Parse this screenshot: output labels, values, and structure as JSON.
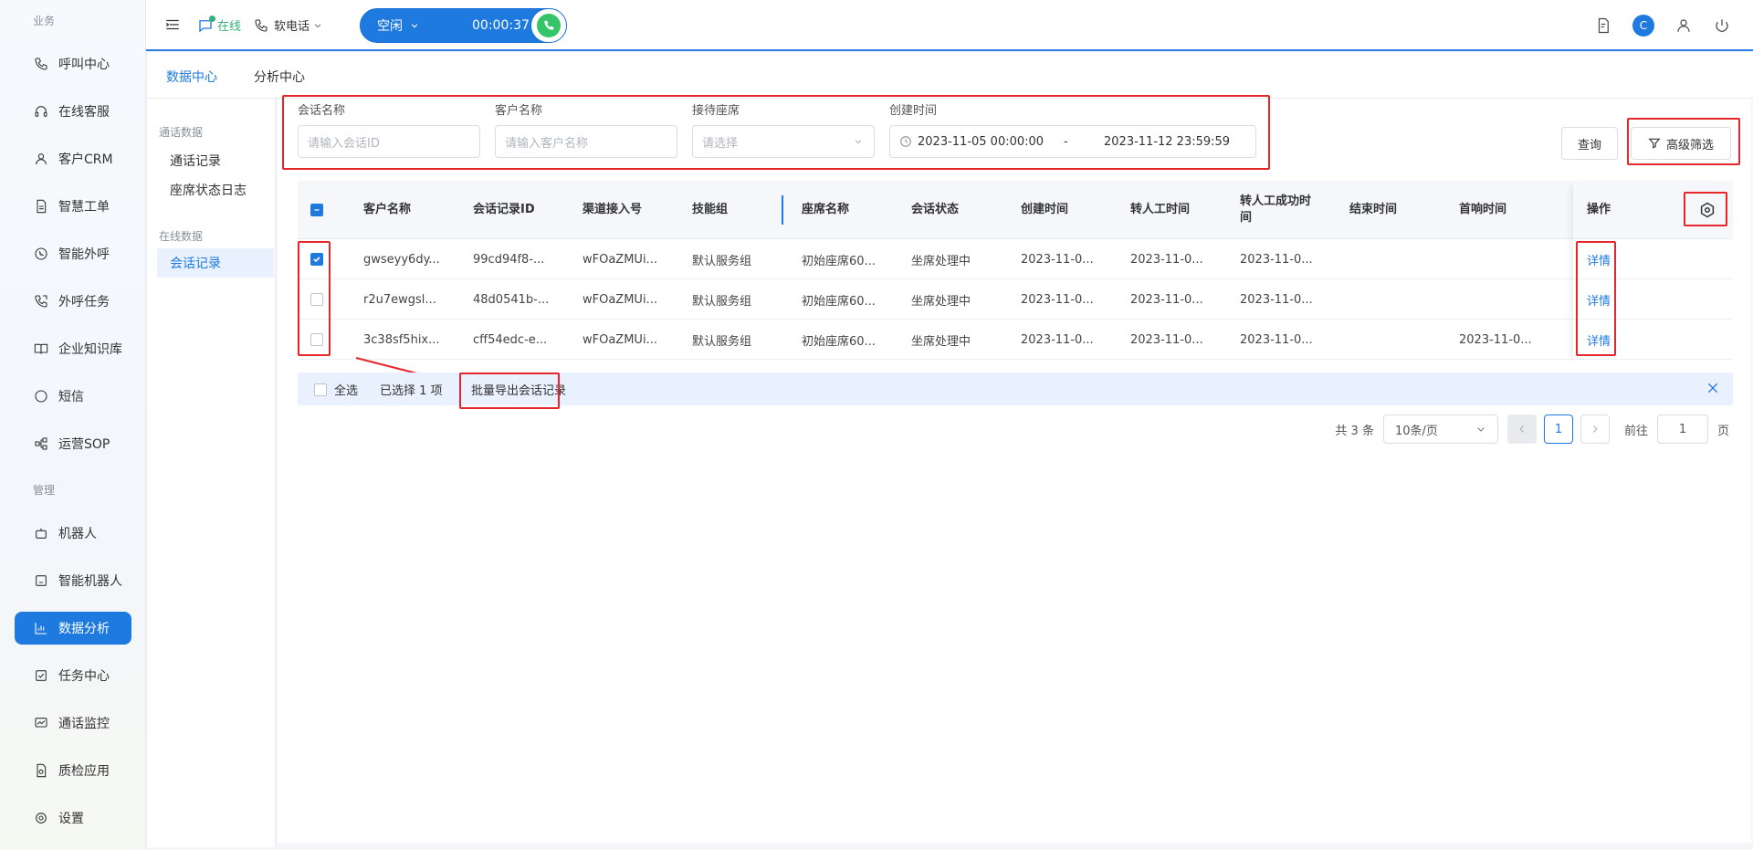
{
  "nav": {
    "group_business": "业务",
    "group_manage": "管理",
    "items": [
      {
        "label": "呼叫中心",
        "icon": "phone-icon"
      },
      {
        "label": "在线客服",
        "icon": "headset-icon"
      },
      {
        "label": "客户CRM",
        "icon": "user-icon"
      },
      {
        "label": "智慧工单",
        "icon": "document-icon"
      },
      {
        "label": "智能外呼",
        "icon": "whatsapp-phone-icon"
      },
      {
        "label": "外呼任务",
        "icon": "phone-task-icon"
      },
      {
        "label": "企业知识库",
        "icon": "book-icon"
      },
      {
        "label": "短信",
        "icon": "sms-icon"
      },
      {
        "label": "运营SOP",
        "icon": "flow-icon"
      },
      {
        "label": "机器人",
        "icon": "robot-icon"
      },
      {
        "label": "智能机器人",
        "icon": "smart-robot-icon"
      },
      {
        "label": "数据分析",
        "icon": "bar-chart-icon",
        "active": true
      },
      {
        "label": "任务中心",
        "icon": "checklist-icon"
      },
      {
        "label": "通话监控",
        "icon": "monitor-icon"
      },
      {
        "label": "质检应用",
        "icon": "quality-icon"
      },
      {
        "label": "设置",
        "icon": "gear-icon"
      }
    ]
  },
  "header": {
    "online_label": "在线",
    "phone_mode": "软电话",
    "call_state": "空闲",
    "timer": "00:00:37",
    "avatar_letter": "C"
  },
  "tabs": [
    {
      "label": "数据中心",
      "active": true
    },
    {
      "label": "分析中心",
      "active": false
    }
  ],
  "submenu": {
    "group_call": "通话数据",
    "group_online": "在线数据",
    "items": [
      {
        "label": "通话记录"
      },
      {
        "label": "座席状态日志"
      },
      {
        "label": "会话记录",
        "active": true
      }
    ]
  },
  "filters": {
    "session_name_label": "会话名称",
    "session_name_placeholder": "请输入会话ID",
    "customer_name_label": "客户名称",
    "customer_name_placeholder": "请输入客户名称",
    "agent_label": "接待座席",
    "agent_placeholder": "请选择",
    "created_label": "创建时间",
    "date_start": "2023-11-05 00:00:00",
    "date_sep": "-",
    "date_end": "2023-11-12 23:59:59",
    "query_button": "查询",
    "advanced_button": "高级筛选"
  },
  "table": {
    "headers": [
      "客户名称",
      "会话记录ID",
      "渠道接入号",
      "技能组",
      "座席名称",
      "会话状态",
      "创建时间",
      "转人工时间",
      "转人工成功时间",
      "结束时间",
      "首响时间",
      "操作"
    ],
    "header_wrap_a": "转人工成功时",
    "header_wrap_b": "间",
    "rows": [
      {
        "checked": true,
        "customer": "gwseyy6dy...",
        "id": "99cd94f8-...",
        "channel": "wFOaZMUi...",
        "group": "默认服务组",
        "agent": "初始座席60...",
        "status": "坐席处理中",
        "created": "2023-11-0...",
        "transfer": "2023-11-0...",
        "transfer_ok": "2023-11-0...",
        "end": "",
        "first_resp": "",
        "op": "详情"
      },
      {
        "checked": false,
        "customer": "r2u7ewgsl...",
        "id": "48d0541b-...",
        "channel": "wFOaZMUi...",
        "group": "默认服务组",
        "agent": "初始座席60...",
        "status": "坐席处理中",
        "created": "2023-11-0...",
        "transfer": "2023-11-0...",
        "transfer_ok": "2023-11-0...",
        "end": "",
        "first_resp": "",
        "op": "详情"
      },
      {
        "checked": false,
        "customer": "3c38sf5hix...",
        "id": "cff54edc-e...",
        "channel": "wFOaZMUi...",
        "group": "默认服务组",
        "agent": "初始座席60...",
        "status": "坐席处理中",
        "created": "2023-11-0...",
        "transfer": "2023-11-0...",
        "transfer_ok": "2023-11-0...",
        "end": "",
        "first_resp": "2023-11-0...",
        "op": "详情"
      }
    ]
  },
  "batch": {
    "select_all": "全选",
    "selected_text": "已选择 1 项",
    "export_link": "批量导出会话记录"
  },
  "pager": {
    "total": "共 3 条",
    "page_size": "10条/页",
    "current": "1",
    "goto_label": "前往",
    "goto_value": "1",
    "page_unit": "页"
  },
  "colors": {
    "primary": "#1f7ae0",
    "highlight": "#e5262b",
    "online": "#34b27b",
    "answer": "#36c46b"
  }
}
